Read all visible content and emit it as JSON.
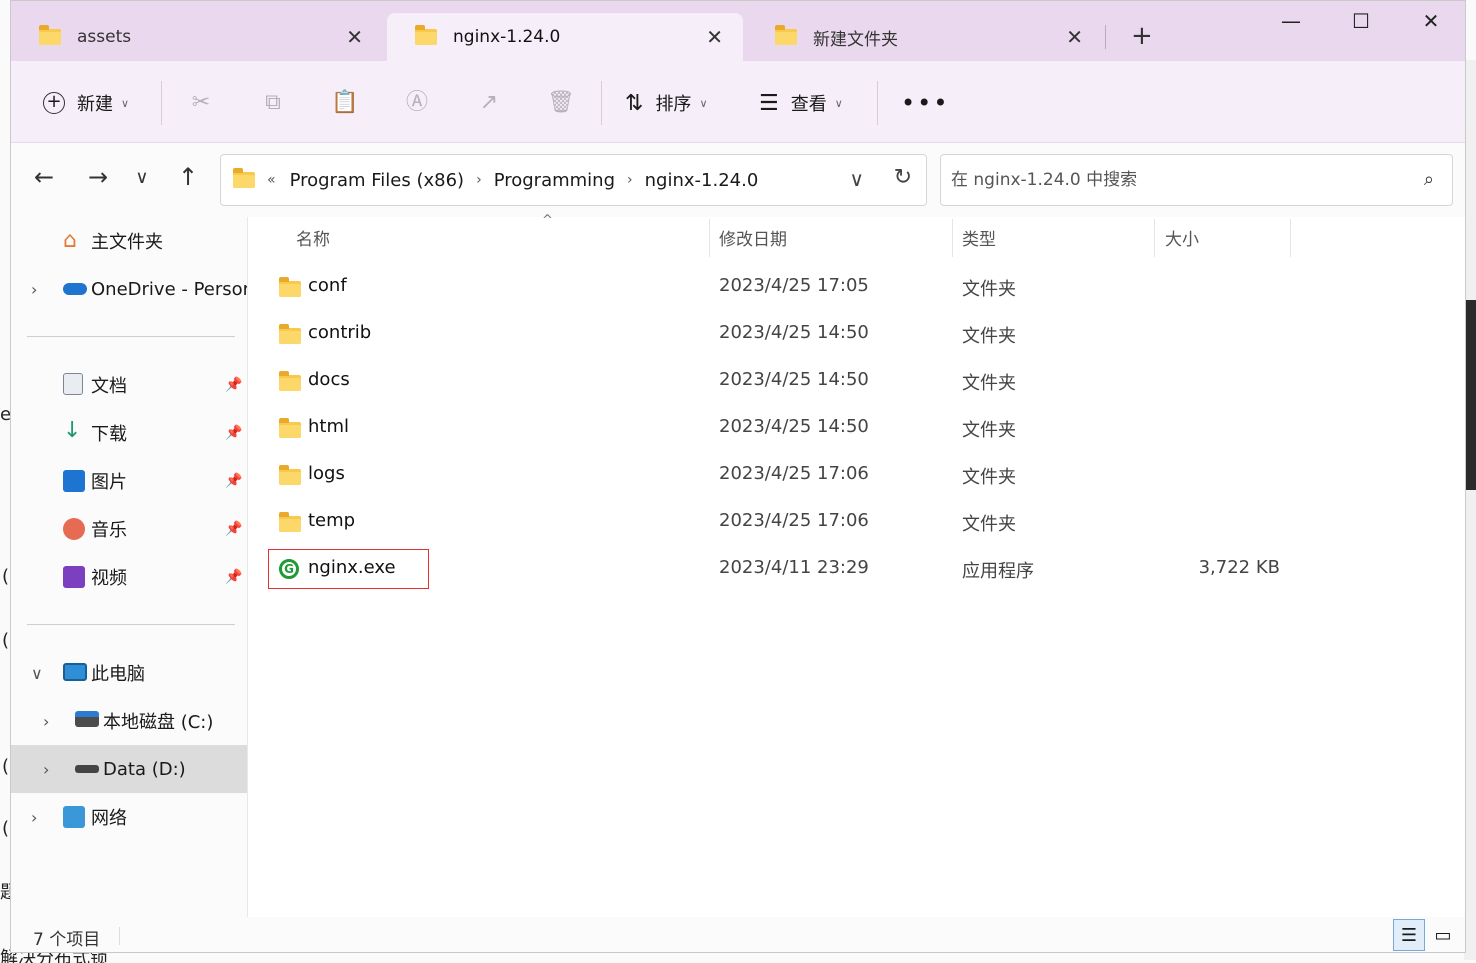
{
  "tabs": [
    {
      "label": "assets",
      "active": false
    },
    {
      "label": "nginx-1.24.0",
      "active": true
    },
    {
      "label": "新建文件夹",
      "active": false
    }
  ],
  "toolbar": {
    "new_label": "新建",
    "sort_label": "排序",
    "view_label": "查看"
  },
  "address": {
    "breadcrumbs": [
      "Program Files (x86)",
      "Programming",
      "nginx-1.24.0"
    ]
  },
  "search": {
    "placeholder": "在 nginx-1.24.0 中搜索"
  },
  "sidebar": {
    "home": "主文件夹",
    "onedrive": "OneDrive - Persor",
    "quick": [
      {
        "label": "文档"
      },
      {
        "label": "下载"
      },
      {
        "label": "图片"
      },
      {
        "label": "音乐"
      },
      {
        "label": "视频"
      }
    ],
    "this_pc": "此电脑",
    "drive_c": "本地磁盘 (C:)",
    "drive_d": "Data (D:)",
    "network": "网络"
  },
  "columns": {
    "name": "名称",
    "date": "修改日期",
    "type": "类型",
    "size": "大小"
  },
  "files": [
    {
      "name": "conf",
      "date": "2023/4/25 17:05",
      "type": "文件夹",
      "size": ""
    },
    {
      "name": "contrib",
      "date": "2023/4/25 14:50",
      "type": "文件夹",
      "size": ""
    },
    {
      "name": "docs",
      "date": "2023/4/25 14:50",
      "type": "文件夹",
      "size": ""
    },
    {
      "name": "html",
      "date": "2023/4/25 14:50",
      "type": "文件夹",
      "size": ""
    },
    {
      "name": "logs",
      "date": "2023/4/25 17:06",
      "type": "文件夹",
      "size": ""
    },
    {
      "name": "temp",
      "date": "2023/4/25 17:06",
      "type": "文件夹",
      "size": ""
    },
    {
      "name": "nginx.exe",
      "date": "2023/4/11 23:29",
      "type": "应用程序",
      "size": "3,722 KB"
    }
  ],
  "status": {
    "item_count": "7 个项目"
  },
  "background": {
    "bottom_text": "解决分布式锁",
    "frag_e": "e",
    "frag_paren": "(",
    "frag_ti": "题"
  },
  "colors": {
    "tabbar_bg": "#ead9ee",
    "toolbar_bg": "#f6eef8",
    "folder": "#f8c94a",
    "nginx_green": "#1f9a37",
    "highlight_border": "#e53030"
  }
}
